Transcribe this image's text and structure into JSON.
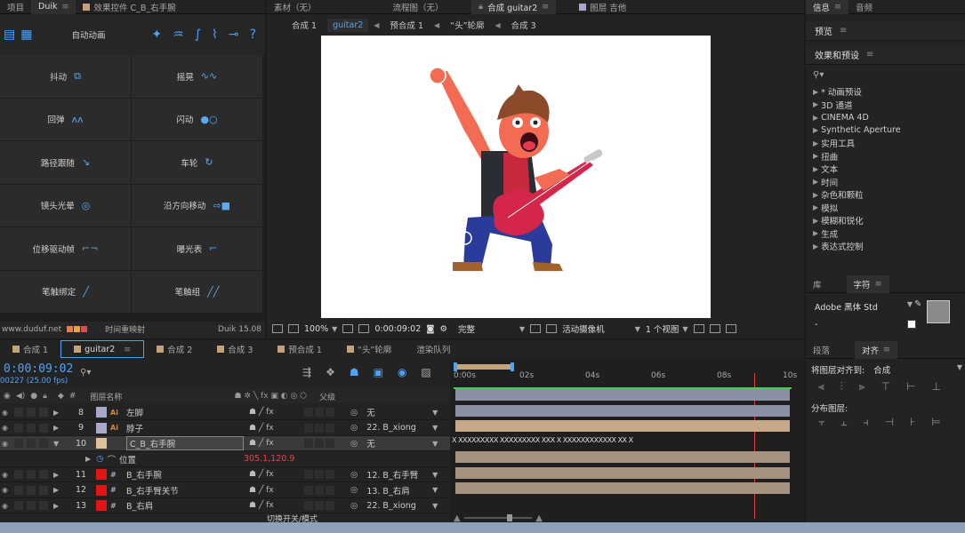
{
  "left_tabs": [
    {
      "label": "项目",
      "active": false
    },
    {
      "label": "Duik",
      "active": true
    },
    {
      "label": "效果控件 C_B_右手腕",
      "active": false
    }
  ],
  "duik": {
    "mode_label": "自动动画",
    "buttons": [
      "抖动",
      "摇晃",
      "回弹",
      "闪动",
      "路径跟随",
      "车轮",
      "镜头光晕",
      "沿方向移动",
      "位移驱动帧",
      "曝光表",
      "笔触绑定",
      "笔触组"
    ],
    "footer_url": "www.duduf.net",
    "footer_partial": "时间重映射",
    "version": "Duik 15.08"
  },
  "comp_tabs": [
    {
      "label": "素材（无）"
    },
    {
      "label": "流程图（无）"
    },
    {
      "label": "合成 guitar2",
      "active": true
    },
    {
      "label": "图层 吉他"
    }
  ],
  "comp_nav": [
    "合成 1",
    "guitar2",
    "预合成 1",
    "“头”轮廓",
    "合成 3"
  ],
  "comp_nav_active": "guitar2",
  "comp_tools": {
    "zoom": "100%",
    "time": "0:00:09:02",
    "quality": "完整",
    "camera": "活动摄像机",
    "views": "1 个视图"
  },
  "right": {
    "top_tabs": [
      "信息",
      "音频"
    ],
    "preview": "预览",
    "fx_title": "效果和预设",
    "fx_search_placeholder": "",
    "fx_items": [
      "* 动画预设",
      "3D 通道",
      "CINEMA 4D",
      "Synthetic Aperture",
      "实用工具",
      "扭曲",
      "文本",
      "时间",
      "杂色和颗粒",
      "模拟",
      "模糊和锐化",
      "生成",
      "表达式控制"
    ],
    "lib_tabs": [
      "库",
      "字符"
    ],
    "font": "Adobe 黑体 Std",
    "font_style": "-",
    "para_tabs": [
      "段落",
      "对齐"
    ],
    "align_to_label": "将图层对齐到:",
    "align_to_value": "合成",
    "distribute_label": "分布图层:"
  },
  "timeline": {
    "tabs": [
      {
        "label": "合成 1",
        "color": "#c4a37a"
      },
      {
        "label": "guitar2",
        "color": "#c4a37a",
        "active": true
      },
      {
        "label": "合成 2",
        "color": "#c4a37a"
      },
      {
        "label": "合成 3",
        "color": "#c4a37a"
      },
      {
        "label": "预合成 1",
        "color": "#c4a37a"
      },
      {
        "label": "“头”轮廓",
        "color": "#c4a37a"
      },
      {
        "label": "渲染队列",
        "color": ""
      }
    ],
    "timecode": "0:00:09:02",
    "fps": "00227 (25.00 fps)",
    "col_hash": "#",
    "col_name": "图层名称",
    "col_parent": "父级",
    "ruler_ticks": [
      "0:00s",
      "02s",
      "04s",
      "06s",
      "08s",
      "10s"
    ],
    "current_time_fraction": 0.894,
    "layers": [
      {
        "num": "8",
        "name": "左脚",
        "type": "Ai",
        "label_color": "#a9a9c9",
        "parent": "无",
        "bar_color": "#8b8fa3"
      },
      {
        "num": "9",
        "name": "脖子",
        "type": "Ai",
        "label_color": "#a9a9c9",
        "parent": "22. B_xiong",
        "bar_color": "#8b8fa3"
      },
      {
        "num": "10",
        "name": "C_B_右手腕",
        "type": "",
        "label_color": "#e0c29a",
        "parent": "无",
        "bar_color": "#c7a98a",
        "selected": true
      },
      {
        "num": "",
        "name": "位置",
        "type": "",
        "label_color": "",
        "parent": "",
        "value": "305.1,120.9"
      },
      {
        "num": "11",
        "name": "B_右手腕",
        "type": "#",
        "label_color": "#e01616",
        "parent": "12. B_右手臂",
        "bar_color": "#a59180"
      },
      {
        "num": "12",
        "name": "B_右手臂关节",
        "type": "#",
        "label_color": "#e01616",
        "parent": "13. B_右肩",
        "bar_color": "#a59180"
      },
      {
        "num": "13",
        "name": "B_右肩",
        "type": "#",
        "label_color": "#e01616",
        "parent": "22. B_xiong",
        "bar_color": "#a59180"
      }
    ],
    "footer": "切换开关/模式"
  }
}
